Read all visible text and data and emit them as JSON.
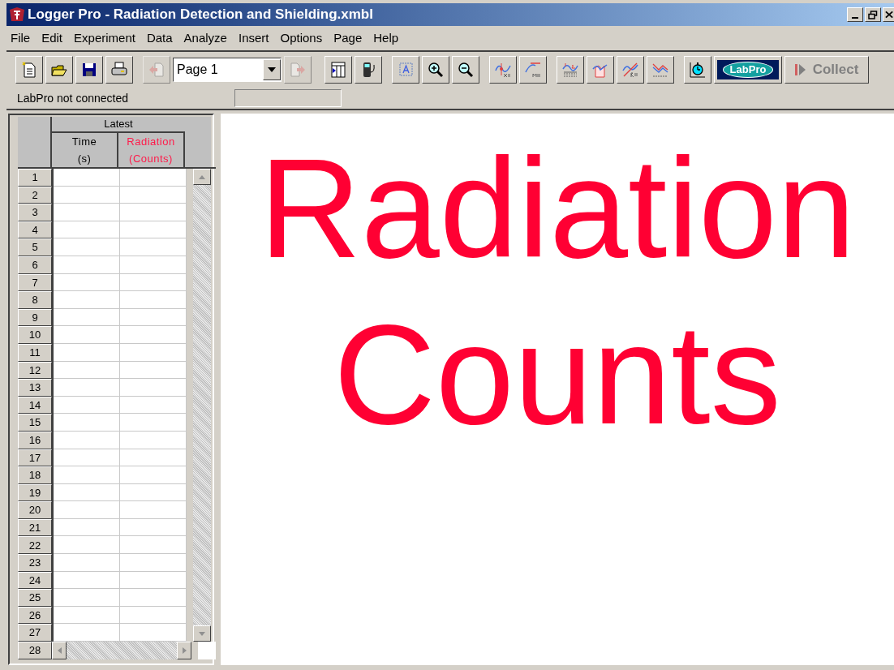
{
  "window": {
    "title": "Logger Pro - Radiation Detection and Shielding.xmbl"
  },
  "menu": [
    {
      "label": "File"
    },
    {
      "label": "Edit"
    },
    {
      "label": "Experiment"
    },
    {
      "label": "Data"
    },
    {
      "label": "Analyze"
    },
    {
      "label": "Insert"
    },
    {
      "label": "Options"
    },
    {
      "label": "Page"
    },
    {
      "label": "Help"
    }
  ],
  "toolbar": {
    "page_select": {
      "value": "Page 1"
    },
    "prev_page": {
      "disabled": true
    },
    "next_page": {
      "disabled": true
    },
    "labpro": {
      "label": "LabPro"
    },
    "collect": {
      "label": "Collect",
      "disabled": true
    }
  },
  "status": {
    "text": "LabPro not connected"
  },
  "table": {
    "group": "Latest",
    "columns": [
      {
        "name": "Time",
        "unit": "(s)",
        "color": "#000000"
      },
      {
        "name": "Radiation",
        "unit": "(Counts)",
        "color": "#ff1a4a"
      }
    ],
    "rows": [
      {
        "number": "1"
      },
      {
        "number": "2"
      },
      {
        "number": "3"
      },
      {
        "number": "4"
      },
      {
        "number": "5"
      },
      {
        "number": "6"
      },
      {
        "number": "7"
      },
      {
        "number": "8"
      },
      {
        "number": "9"
      },
      {
        "number": "10"
      },
      {
        "number": "11"
      },
      {
        "number": "12"
      },
      {
        "number": "13"
      },
      {
        "number": "14"
      },
      {
        "number": "15"
      },
      {
        "number": "16"
      },
      {
        "number": "17"
      },
      {
        "number": "18"
      },
      {
        "number": "19"
      },
      {
        "number": "20"
      },
      {
        "number": "21"
      },
      {
        "number": "22"
      },
      {
        "number": "23"
      },
      {
        "number": "24"
      },
      {
        "number": "25"
      },
      {
        "number": "26"
      },
      {
        "number": "27"
      },
      {
        "number": "28"
      }
    ]
  },
  "canvas": {
    "lines": [
      "Radiation",
      "Counts"
    ]
  }
}
